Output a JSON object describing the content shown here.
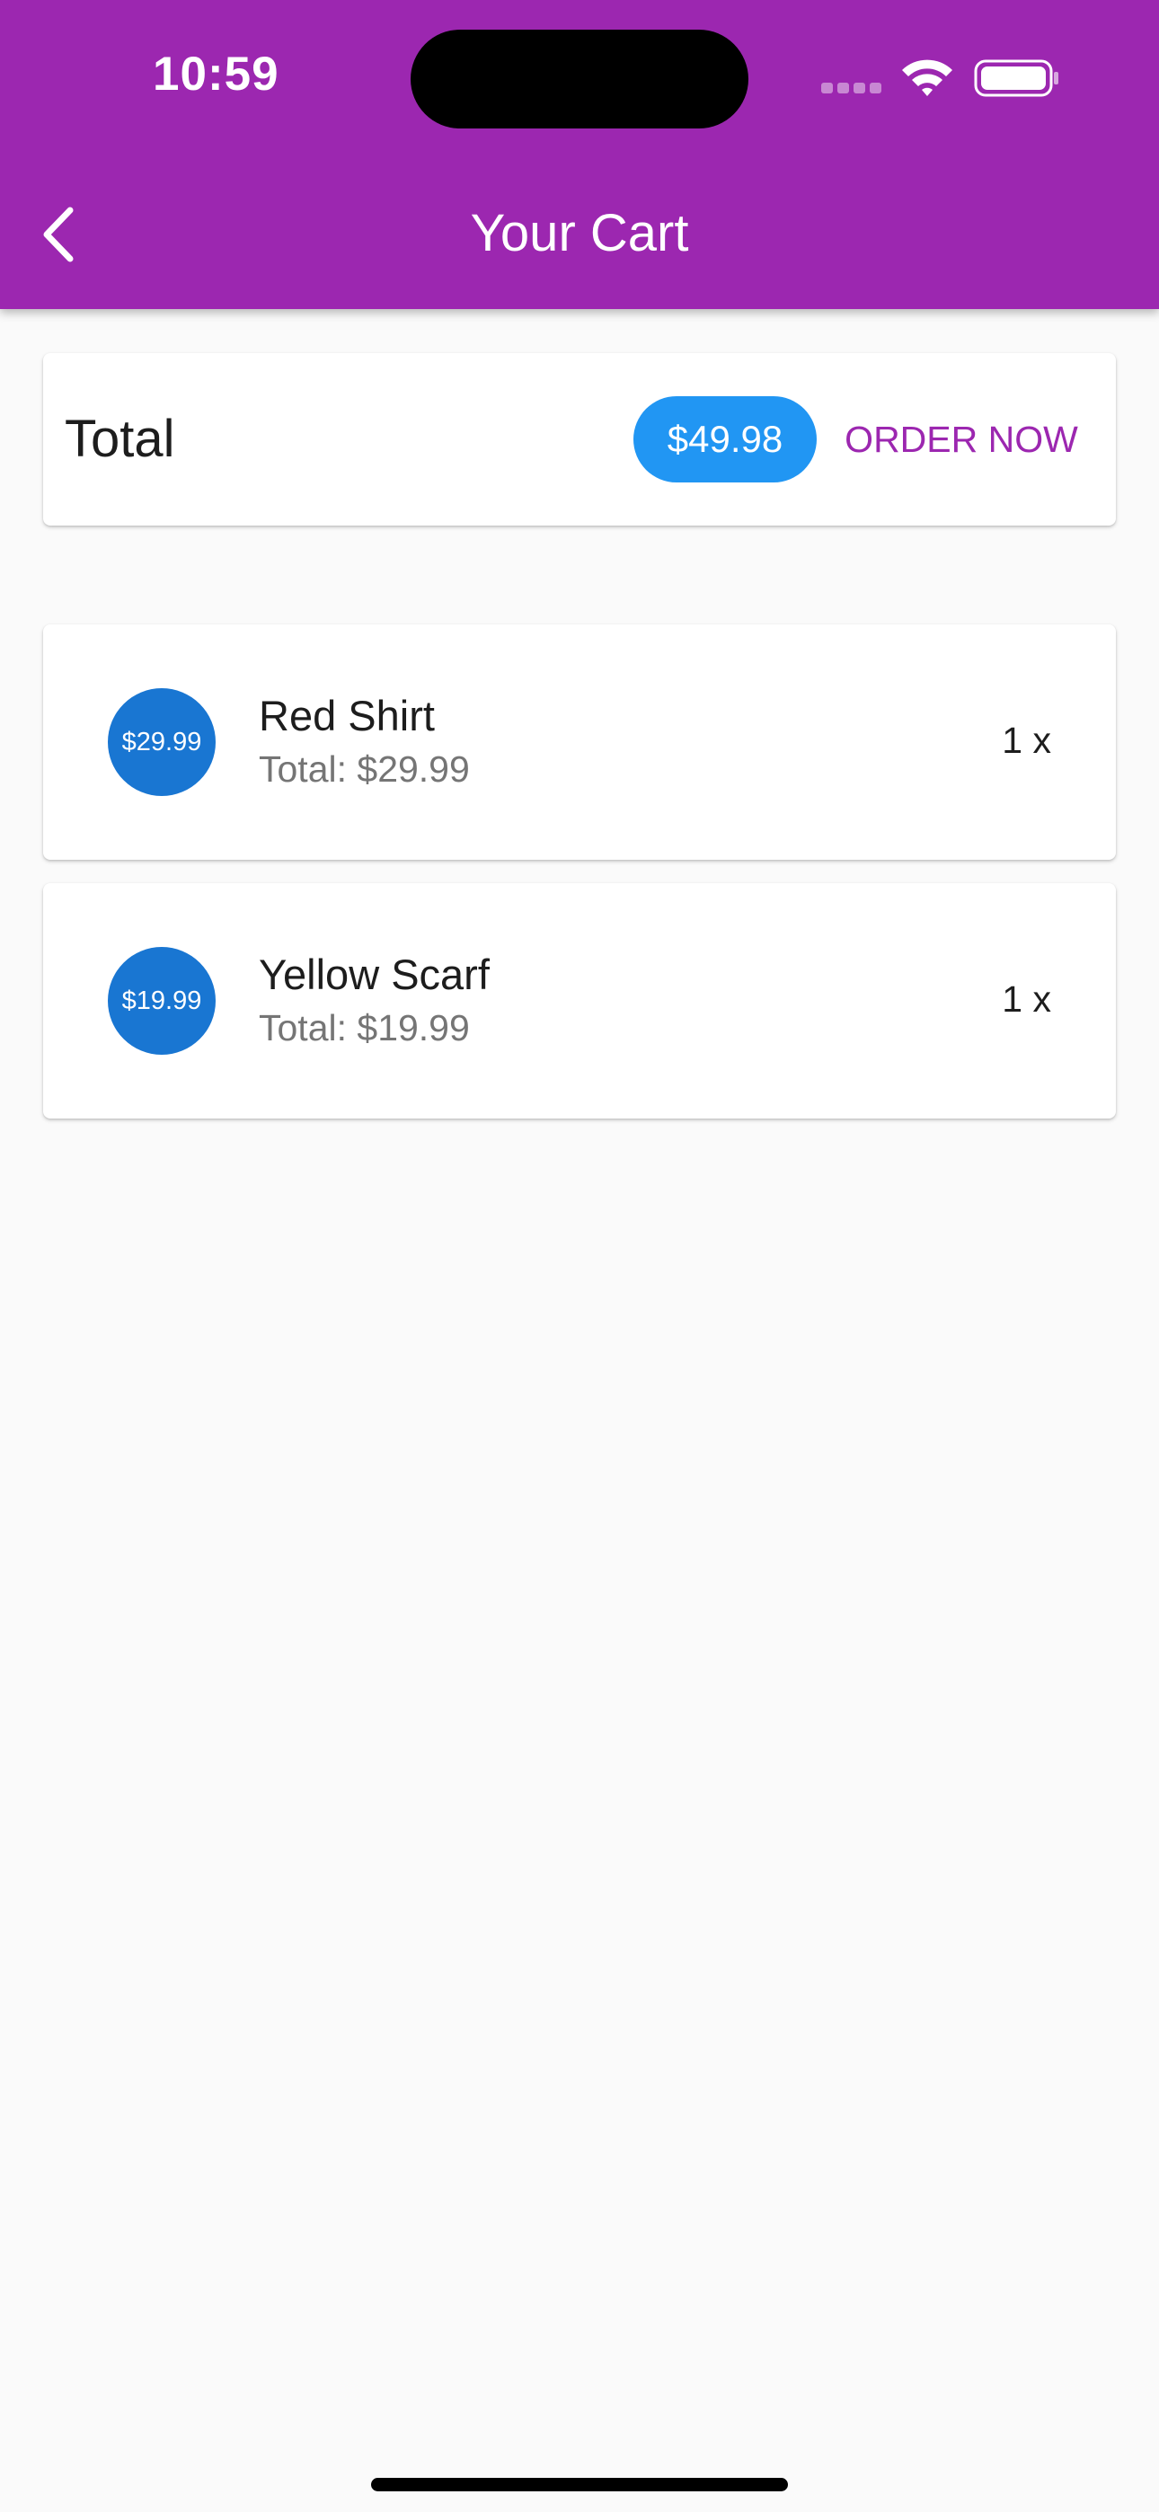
{
  "status_bar": {
    "time": "10:59"
  },
  "app_bar": {
    "title": "Your Cart",
    "back_icon": "back-arrow-icon"
  },
  "summary": {
    "label": "Total",
    "amount": "$49.98",
    "order_label": "ORDER NOW"
  },
  "items": [
    {
      "avatar": "$29.99",
      "title": "Red Shirt",
      "subtitle": "Total: $29.99",
      "qty": "1 x"
    },
    {
      "avatar": "$19.99",
      "title": "Yellow Scarf",
      "subtitle": "Total: $19.99",
      "qty": "1 x"
    }
  ],
  "colors": {
    "primary": "#9c27b0",
    "chip": "#2196f3",
    "avatar": "#1976d2",
    "background": "#fafafa"
  }
}
